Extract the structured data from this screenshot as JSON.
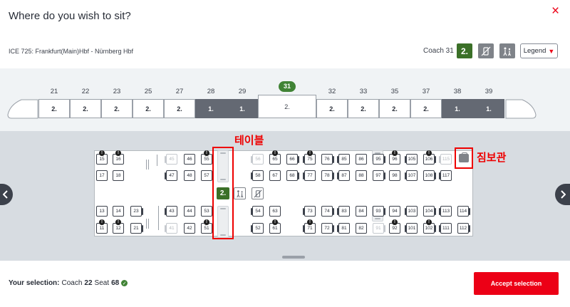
{
  "dialog": {
    "title": "Where do you wish to sit?",
    "close_icon": "×"
  },
  "train": {
    "route": "ICE 725: Frankfurt(Main)Hbf - Nürnberg Hbf",
    "coach_label": "Coach 31",
    "coach_class": "2.",
    "legend_label": "Legend"
  },
  "cars": [
    {
      "num": "21",
      "cls": "2."
    },
    {
      "num": "22",
      "cls": "2."
    },
    {
      "num": "23",
      "cls": "2."
    },
    {
      "num": "25",
      "cls": "2."
    },
    {
      "num": "27",
      "cls": "2."
    },
    {
      "num": "28",
      "cls": "1."
    },
    {
      "num": "29",
      "cls": "1."
    },
    {
      "num": "31",
      "cls": "2."
    },
    {
      "num": "32",
      "cls": "2."
    },
    {
      "num": "33",
      "cls": "2."
    },
    {
      "num": "35",
      "cls": "2."
    },
    {
      "num": "37",
      "cls": "2."
    },
    {
      "num": "38",
      "cls": "1."
    },
    {
      "num": "39",
      "cls": "1."
    }
  ],
  "seats": [
    {
      "n": "15",
      "c": "c1",
      "r": "r1",
      "res": true
    },
    {
      "n": "16",
      "c": "c2",
      "r": "r1",
      "res": true
    },
    {
      "n": "17",
      "c": "c1",
      "r": "r2"
    },
    {
      "n": "18",
      "c": "c2",
      "r": "r2"
    },
    {
      "n": "13",
      "c": "c1",
      "r": "r3"
    },
    {
      "n": "14",
      "c": "c2",
      "r": "r3"
    },
    {
      "n": "11",
      "c": "c1",
      "r": "r4",
      "res": true
    },
    {
      "n": "12",
      "c": "c2",
      "r": "r4",
      "res": true
    },
    {
      "n": "23",
      "c": "c3",
      "r": "r3"
    },
    {
      "n": "21",
      "c": "c3",
      "r": "r4"
    },
    {
      "n": "45",
      "c": "c4",
      "r": "r1",
      "dis": true
    },
    {
      "n": "46",
      "c": "c5",
      "r": "r1"
    },
    {
      "n": "55",
      "c": "c6",
      "r": "r1",
      "res": true
    },
    {
      "n": "47",
      "c": "c4",
      "r": "r2"
    },
    {
      "n": "48",
      "c": "c5",
      "r": "r2"
    },
    {
      "n": "57",
      "c": "c6",
      "r": "r2"
    },
    {
      "n": "43",
      "c": "c4",
      "r": "r3"
    },
    {
      "n": "44",
      "c": "c5",
      "r": "r3"
    },
    {
      "n": "53",
      "c": "c6",
      "r": "r3"
    },
    {
      "n": "41",
      "c": "c4",
      "r": "r4",
      "dis": true
    },
    {
      "n": "42",
      "c": "c5",
      "r": "r4"
    },
    {
      "n": "51",
      "c": "c6",
      "r": "r4",
      "res": true
    },
    {
      "n": "56",
      "c": "c7",
      "r": "r1",
      "dis": true
    },
    {
      "n": "65",
      "c": "c8",
      "r": "r1",
      "res": true
    },
    {
      "n": "66",
      "c": "c9",
      "r": "r1"
    },
    {
      "n": "58",
      "c": "c7",
      "r": "r2"
    },
    {
      "n": "67",
      "c": "c8",
      "r": "r2"
    },
    {
      "n": "68",
      "c": "c9",
      "r": "r2"
    },
    {
      "n": "54",
      "c": "c7",
      "r": "r3"
    },
    {
      "n": "63",
      "c": "c8",
      "r": "r3"
    },
    {
      "n": "52",
      "c": "c7",
      "r": "r4"
    },
    {
      "n": "61",
      "c": "c8",
      "r": "r4",
      "res": true
    },
    {
      "n": "75",
      "c": "c10",
      "r": "r1",
      "res": true
    },
    {
      "n": "76",
      "c": "c11",
      "r": "r1"
    },
    {
      "n": "85",
      "c": "c12",
      "r": "r1"
    },
    {
      "n": "86",
      "c": "c13",
      "r": "r1"
    },
    {
      "n": "95",
      "c": "c14",
      "r": "r1"
    },
    {
      "n": "77",
      "c": "c10",
      "r": "r2"
    },
    {
      "n": "78",
      "c": "c11",
      "r": "r2"
    },
    {
      "n": "87",
      "c": "c12",
      "r": "r2"
    },
    {
      "n": "88",
      "c": "c13",
      "r": "r2"
    },
    {
      "n": "97",
      "c": "c14",
      "r": "r2"
    },
    {
      "n": "73",
      "c": "c10",
      "r": "r3"
    },
    {
      "n": "74",
      "c": "c11",
      "r": "r3"
    },
    {
      "n": "83",
      "c": "c12",
      "r": "r3"
    },
    {
      "n": "84",
      "c": "c13",
      "r": "r3"
    },
    {
      "n": "93",
      "c": "c14",
      "r": "r3"
    },
    {
      "n": "71",
      "c": "c10",
      "r": "r4",
      "res": true
    },
    {
      "n": "72",
      "c": "c11",
      "r": "r4"
    },
    {
      "n": "81",
      "c": "c12",
      "r": "r4"
    },
    {
      "n": "82",
      "c": "c13",
      "r": "r4"
    },
    {
      "n": "91",
      "c": "c14",
      "r": "r4",
      "dis": true
    },
    {
      "n": "96",
      "c": "c15",
      "r": "r1",
      "res": true
    },
    {
      "n": "105",
      "c": "c16",
      "r": "r1"
    },
    {
      "n": "106",
      "c": "c17",
      "r": "r1",
      "res": true
    },
    {
      "n": "115",
      "c": "c18",
      "r": "r1",
      "dis": true
    },
    {
      "n": "98",
      "c": "c15",
      "r": "r2"
    },
    {
      "n": "107",
      "c": "c16",
      "r": "r2"
    },
    {
      "n": "108",
      "c": "c17",
      "r": "r2"
    },
    {
      "n": "117",
      "c": "c18",
      "r": "r2"
    },
    {
      "n": "94",
      "c": "c15",
      "r": "r3"
    },
    {
      "n": "103",
      "c": "c16",
      "r": "r3"
    },
    {
      "n": "104",
      "c": "c17",
      "r": "r3"
    },
    {
      "n": "113",
      "c": "c18",
      "r": "r3"
    },
    {
      "n": "114",
      "c": "c19",
      "r": "r3"
    },
    {
      "n": "92",
      "c": "c15",
      "r": "r4",
      "res": true
    },
    {
      "n": "101",
      "c": "c16",
      "r": "r4"
    },
    {
      "n": "102",
      "c": "c17",
      "r": "r4",
      "res": true
    },
    {
      "n": "111",
      "c": "c18",
      "r": "r4"
    },
    {
      "n": "112",
      "c": "c19",
      "r": "r4"
    }
  ],
  "coach_class_badge": "2.",
  "annotations": {
    "table": "테이블",
    "luggage": "짐보관"
  },
  "footer": {
    "selection_label": "Your selection:",
    "coach_word": "Coach",
    "coach_value": "22",
    "seat_word": "Seat",
    "seat_value": "68",
    "accept_label": "Accept selection"
  },
  "colors": {
    "brand_red": "#ec0016",
    "second_class_green": "#3b7028",
    "first_class_grey": "#646973"
  }
}
